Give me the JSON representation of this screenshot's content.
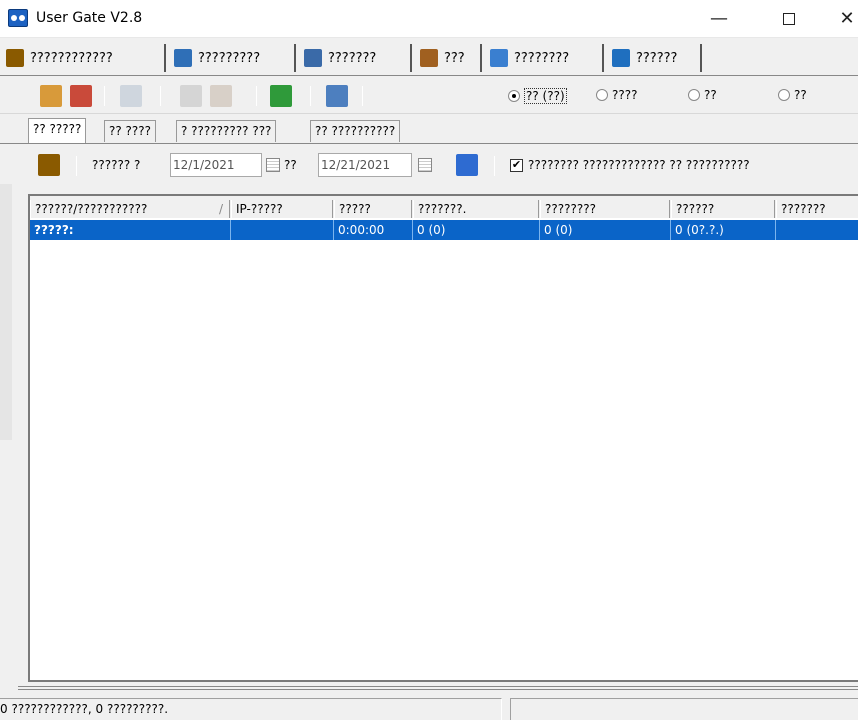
{
  "window": {
    "title": "User Gate V2.8",
    "minimize": "—",
    "close": "✕"
  },
  "main_tabs": [
    {
      "label": "????????????",
      "icon": "users-icon",
      "color": "#8a5a00"
    },
    {
      "label": "?????????",
      "icon": "network-plug-icon",
      "color": "#2f6fb7"
    },
    {
      "label": "???????",
      "icon": "monitor-icon",
      "color": "#3a6aa8"
    },
    {
      "label": "???",
      "icon": "home-icon",
      "color": "#a06020"
    },
    {
      "label": "????????",
      "icon": "settings-tools-icon",
      "color": "#3a7fd0"
    },
    {
      "label": "??????",
      "icon": "help-book-icon",
      "color": "#1f6fbf"
    }
  ],
  "toolbar": {
    "radio_options": [
      {
        "label": "?? (??)",
        "checked": true
      },
      {
        "label": "????",
        "checked": false
      },
      {
        "label": "??",
        "checked": false
      },
      {
        "label": "??",
        "checked": false
      }
    ]
  },
  "sub_tabs": [
    {
      "label": "?? ?????",
      "active": true
    },
    {
      "label": "?? ????",
      "active": false
    },
    {
      "label": "? ????????? ???",
      "active": false
    },
    {
      "label": "?? ??????????",
      "active": false
    }
  ],
  "filter": {
    "period_label": "?????? ?",
    "date_from": "12/1/2021",
    "to_label": "??",
    "date_to": "12/21/2021",
    "checkbox_checked_mark": "✔",
    "checkbox_label": "???????? ????????????? ?? ??????????"
  },
  "table": {
    "columns": [
      "??????/???????????",
      "IP-?????",
      "?????",
      "???????.",
      "????????",
      "??????",
      "???????"
    ],
    "sort_indicator": "/",
    "rows": [
      [
        "?????:",
        "",
        "0:00:00",
        "0 (0)",
        "0 (0)",
        "0 (0?.?.)",
        ""
      ]
    ]
  },
  "status": {
    "text": "0 ????????????, 0 ?????????."
  },
  "colors": {
    "selection": "#0a64c8",
    "window_bg": "#f0f0f0"
  }
}
